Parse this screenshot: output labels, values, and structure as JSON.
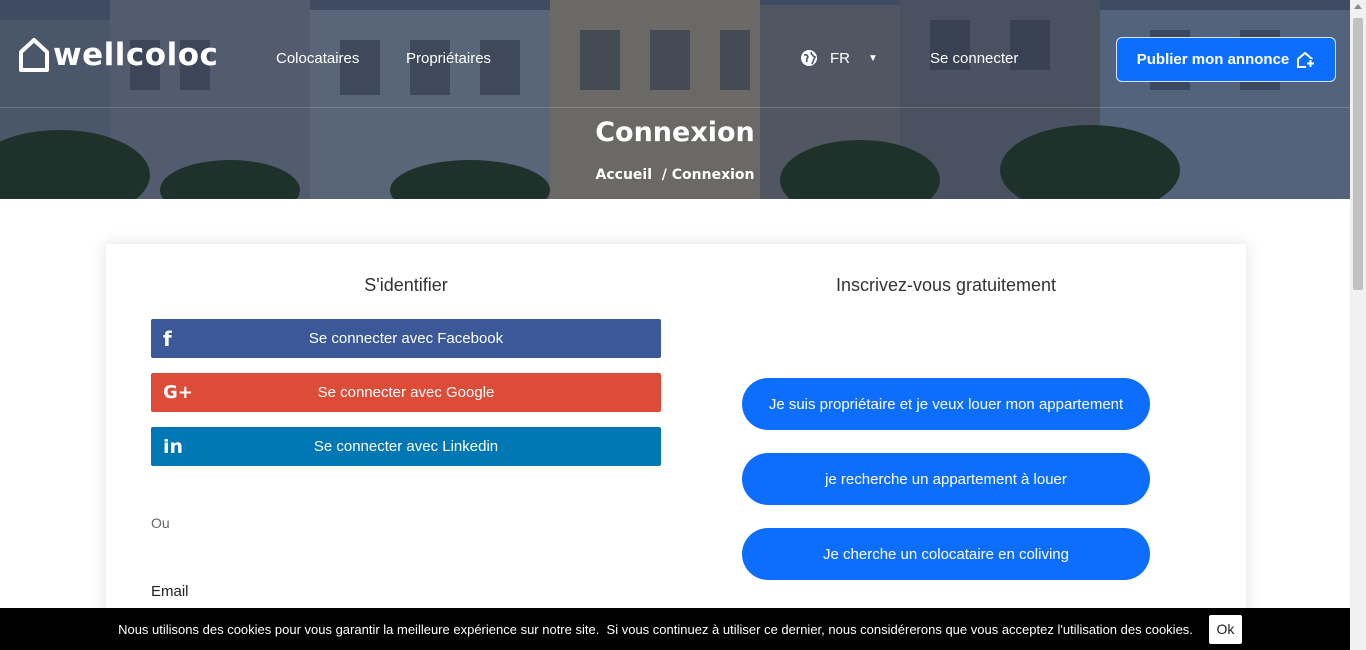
{
  "brand": {
    "name": "wellcoloc"
  },
  "nav": {
    "links": [
      "Colocataires",
      "Propriétaires"
    ],
    "language": "FR",
    "login": "Se connecter",
    "publish": "Publier mon annonce"
  },
  "hero": {
    "title": "Connexion",
    "breadcrumb": "Accueil  / Connexion"
  },
  "signin": {
    "title": "S'identifier",
    "facebook": "Se connecter avec Facebook",
    "google": "Se connecter avec Google",
    "linkedin": "Se connecter avec Linkedin",
    "or": "Ou",
    "email_label": "Email"
  },
  "register": {
    "title": "Inscrivez-vous gratuitement",
    "options": [
      "Je suis propriétaire et je veux louer mon appartement",
      "je recherche un appartement à louer",
      "Je cherche un colocataire en coliving"
    ]
  },
  "cookie": {
    "text": "Nous utilisons des cookies pour vous garantir la meilleure expérience sur notre site.  Si vous continuez à utiliser ce dernier, nous considérerons que vous acceptez l'utilisation des cookies.",
    "ok": "Ok"
  },
  "colors": {
    "primary": "#0d6efd",
    "facebook": "#3b5998",
    "google": "#dd4b39",
    "linkedin": "#0077b5"
  }
}
